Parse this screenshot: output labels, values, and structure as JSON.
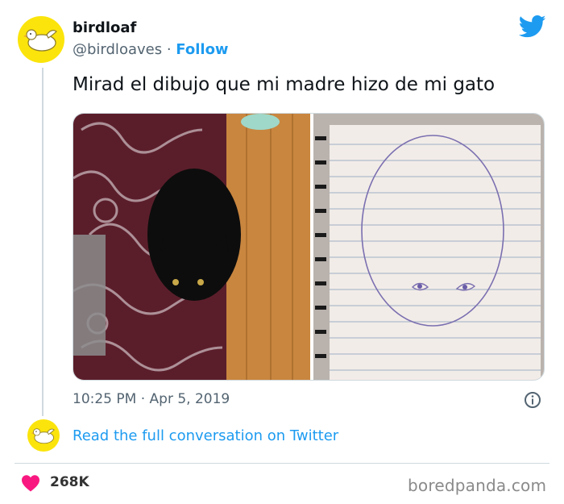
{
  "author": {
    "display_name": "birdloaf",
    "handle": "@birdloaves",
    "separator": "·",
    "follow_label": "Follow"
  },
  "tweet": {
    "text": "Mirad el dibujo que mi madre hizo de mi gato",
    "timestamp": "10:25 PM · Apr 5, 2019"
  },
  "conversation": {
    "link_label": "Read the full conversation on Twitter"
  },
  "engagement": {
    "likes": "268K"
  },
  "watermark": "boredpanda.com",
  "colors": {
    "accent": "#1d9bf0",
    "avatar_bg": "#fbe40b",
    "heart": "#f91880",
    "muted": "#536471"
  },
  "icons": [
    "twitter-bird-icon",
    "info-icon",
    "heart-icon"
  ]
}
